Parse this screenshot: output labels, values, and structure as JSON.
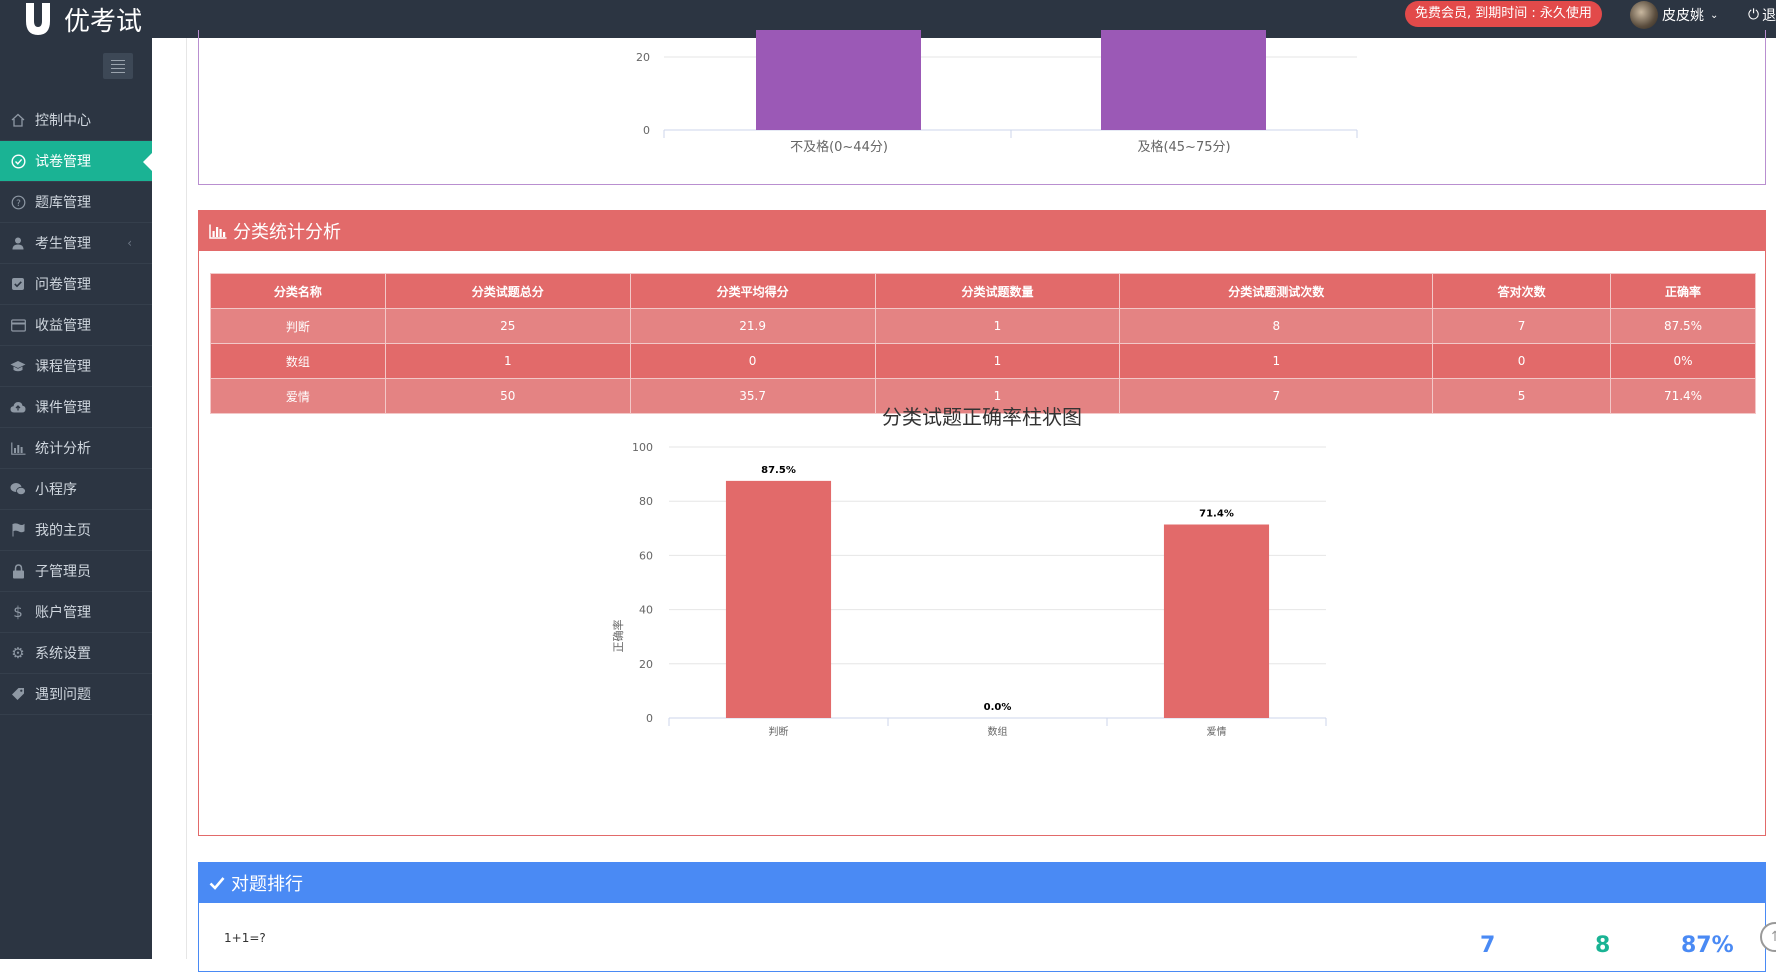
{
  "app": {
    "logo_text": "优考试",
    "member_badge": "免费会员, 到期时间 : 永久使用",
    "user_name": "皮皮姚",
    "logout_label": "退"
  },
  "sidebar": {
    "items": [
      {
        "label": "控制中心",
        "icon": "home-icon"
      },
      {
        "label": "试卷管理",
        "icon": "check-circle-icon",
        "active": true
      },
      {
        "label": "题库管理",
        "icon": "question-circle-icon"
      },
      {
        "label": "考生管理",
        "icon": "user-icon"
      },
      {
        "label": "问卷管理",
        "icon": "checkbox-icon"
      },
      {
        "label": "收益管理",
        "icon": "credit-card-icon"
      },
      {
        "label": "课程管理",
        "icon": "graduation-cap-icon"
      },
      {
        "label": "课件管理",
        "icon": "cloud-upload-icon"
      },
      {
        "label": "统计分析",
        "icon": "bar-chart-icon"
      },
      {
        "label": "小程序",
        "icon": "wechat-icon"
      },
      {
        "label": "我的主页",
        "icon": "flag-icon"
      },
      {
        "label": "子管理员",
        "icon": "lock-icon"
      },
      {
        "label": "账户管理",
        "icon": "dollar-icon"
      },
      {
        "label": "系统设置",
        "icon": "gear-icon"
      },
      {
        "label": "遇到问题",
        "icon": "tag-icon"
      }
    ]
  },
  "colors": {
    "header_bg": "#2c3542",
    "active_menu": "#1ab394",
    "category_red": "#e26a6a",
    "ranking_blue": "#4a8af4",
    "top_bar_purple": "#9b59b6"
  },
  "top_chart": {
    "y_ticks": [
      "0",
      "20"
    ],
    "categories": [
      "不及格(0~44分)",
      "及格(45~75分)"
    ]
  },
  "category_section": {
    "title": "分类统计分析",
    "table": {
      "headers": [
        "分类名称",
        "分类试题总分",
        "分类平均得分",
        "分类试题数量",
        "分类试题测试次数",
        "答对次数",
        "正确率"
      ],
      "rows": [
        [
          "判断",
          "25",
          "21.9",
          "1",
          "8",
          "7",
          "87.5%"
        ],
        [
          "数组",
          "1",
          "0",
          "1",
          "1",
          "0",
          "0%"
        ],
        [
          "爱情",
          "50",
          "35.7",
          "1",
          "7",
          "5",
          "71.4%"
        ]
      ]
    }
  },
  "chart_data": {
    "type": "bar",
    "title": "分类试题正确率柱状图",
    "ylabel": "正确率",
    "xlabel": "",
    "categories": [
      "判断",
      "数组",
      "爱情"
    ],
    "values": [
      87.5,
      0.0,
      71.4
    ],
    "data_labels": [
      "87.5%",
      "0.0%",
      "71.4%"
    ],
    "ylim": [
      0,
      100
    ],
    "y_ticks": [
      0,
      20,
      40,
      60,
      80,
      100
    ],
    "grid": true,
    "color": "#e26a6a"
  },
  "ranking_section": {
    "title": "对题排行",
    "question": "1+1=?",
    "stats": [
      "7",
      "8",
      "87%"
    ]
  }
}
